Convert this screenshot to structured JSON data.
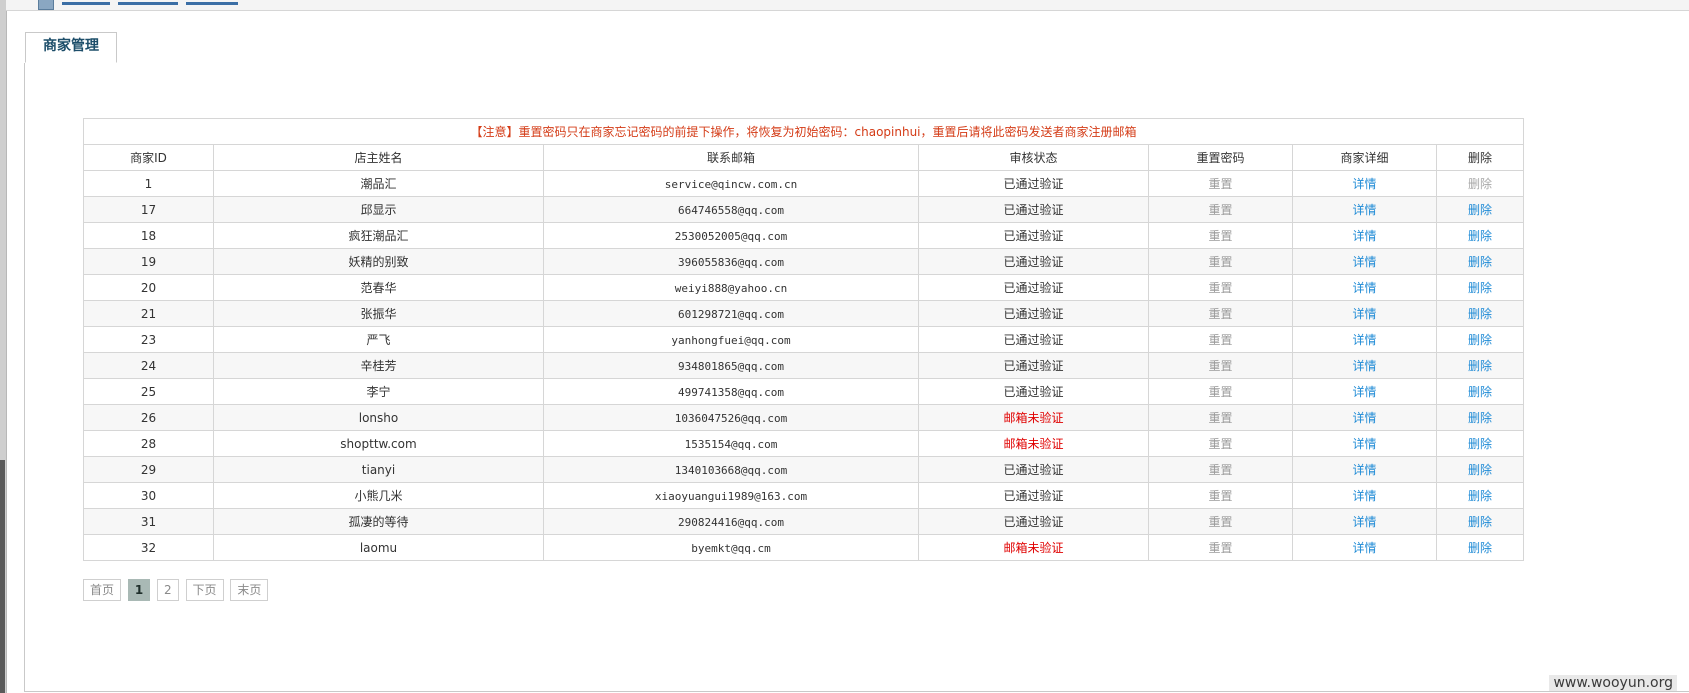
{
  "tab": {
    "label": "商家管理"
  },
  "notice": "【注意】重置密码只在商家忘记密码的前提下操作，将恢复为初始密码：chaopinhui，重置后请将此密码发送者商家注册邮箱",
  "columns": {
    "id": "商家ID",
    "owner": "店主姓名",
    "email": "联系邮箱",
    "status": "审核状态",
    "reset": "重置密码",
    "detail": "商家详细",
    "delete": "删除"
  },
  "labels": {
    "reset": "重置",
    "detail": "详情",
    "delete": "删除"
  },
  "rows": [
    {
      "id": "1",
      "owner": "潮品汇",
      "email": "service@qincw.com.cn",
      "status": "已通过验证",
      "verified": true,
      "delete_enabled": false
    },
    {
      "id": "17",
      "owner": "邱显示",
      "email": "664746558@qq.com",
      "status": "已通过验证",
      "verified": true,
      "delete_enabled": true
    },
    {
      "id": "18",
      "owner": "疯狂潮品汇",
      "email": "2530052005@qq.com",
      "status": "已通过验证",
      "verified": true,
      "delete_enabled": true
    },
    {
      "id": "19",
      "owner": "妖精的别致",
      "email": "396055836@qq.com",
      "status": "已通过验证",
      "verified": true,
      "delete_enabled": true
    },
    {
      "id": "20",
      "owner": "范春华",
      "email": "weiyi888@yahoo.cn",
      "status": "已通过验证",
      "verified": true,
      "delete_enabled": true
    },
    {
      "id": "21",
      "owner": "张振华",
      "email": "601298721@qq.com",
      "status": "已通过验证",
      "verified": true,
      "delete_enabled": true
    },
    {
      "id": "23",
      "owner": "严飞",
      "email": "yanhongfuei@qq.com",
      "status": "已通过验证",
      "verified": true,
      "delete_enabled": true
    },
    {
      "id": "24",
      "owner": "辛桂芳",
      "email": "934801865@qq.com",
      "status": "已通过验证",
      "verified": true,
      "delete_enabled": true
    },
    {
      "id": "25",
      "owner": "李宁",
      "email": "499741358@qq.com",
      "status": "已通过验证",
      "verified": true,
      "delete_enabled": true
    },
    {
      "id": "26",
      "owner": "lonsho",
      "email": "1036047526@qq.com",
      "status": "邮箱未验证",
      "verified": false,
      "delete_enabled": true
    },
    {
      "id": "28",
      "owner": "shopttw.com",
      "email": "1535154@qq.com",
      "status": "邮箱未验证",
      "verified": false,
      "delete_enabled": true
    },
    {
      "id": "29",
      "owner": "tianyi",
      "email": "1340103668@qq.com",
      "status": "已通过验证",
      "verified": true,
      "delete_enabled": true
    },
    {
      "id": "30",
      "owner": "小熊几米",
      "email": "xiaoyuangui1989@163.com",
      "status": "已通过验证",
      "verified": true,
      "delete_enabled": true
    },
    {
      "id": "31",
      "owner": "孤凄的等待",
      "email": "290824416@qq.com",
      "status": "已通过验证",
      "verified": true,
      "delete_enabled": true
    },
    {
      "id": "32",
      "owner": "laomu",
      "email": "byemkt@qq.cm",
      "status": "邮箱未验证",
      "verified": false,
      "delete_enabled": true
    }
  ],
  "pager": {
    "first": "首页",
    "pages": [
      "1",
      "2"
    ],
    "current": "1",
    "next": "下页",
    "last": "末页"
  },
  "watermark": "www.wooyun.org"
}
